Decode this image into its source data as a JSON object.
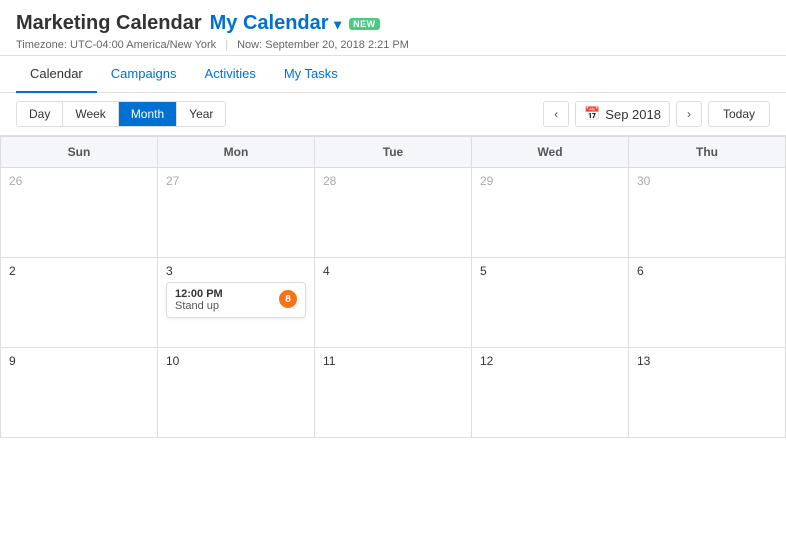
{
  "header": {
    "title": "Marketing Calendar",
    "my_calendar_label": "My Calendar",
    "chevron": "▾",
    "new_badge": "NEW",
    "timezone_label": "Timezone: UTC-04:00 America/New York",
    "now_label": "Now: September 20, 2018 2:21 PM"
  },
  "tabs": [
    {
      "label": "Calendar",
      "active": true
    },
    {
      "label": "Campaigns",
      "active": false
    },
    {
      "label": "Activities",
      "active": false
    },
    {
      "label": "My Tasks",
      "active": false
    }
  ],
  "toolbar": {
    "view_buttons": [
      {
        "label": "Day",
        "active": false
      },
      {
        "label": "Week",
        "active": false
      },
      {
        "label": "Month",
        "active": true
      },
      {
        "label": "Year",
        "active": false
      }
    ],
    "prev_arrow": "‹",
    "next_arrow": "›",
    "calendar_icon": "📅",
    "month_label": "Sep 2018",
    "today_label": "Today"
  },
  "calendar": {
    "weekdays": [
      "Sun",
      "Mon",
      "Tue",
      "Wed",
      "Thu"
    ],
    "weeks": [
      [
        {
          "day": "26",
          "prev": true,
          "events": []
        },
        {
          "day": "27",
          "prev": true,
          "events": []
        },
        {
          "day": "28",
          "prev": true,
          "events": []
        },
        {
          "day": "29",
          "prev": true,
          "events": []
        },
        {
          "day": "30",
          "prev": true,
          "events": []
        }
      ],
      [
        {
          "day": "2",
          "prev": false,
          "events": []
        },
        {
          "day": "3",
          "prev": false,
          "events": [
            {
              "time": "12:00 PM",
              "name": "Stand up",
              "badge": "8"
            }
          ]
        },
        {
          "day": "4",
          "prev": false,
          "events": []
        },
        {
          "day": "5",
          "prev": false,
          "events": []
        },
        {
          "day": "6",
          "prev": false,
          "events": []
        }
      ],
      [
        {
          "day": "9",
          "prev": false,
          "events": []
        },
        {
          "day": "10",
          "prev": false,
          "events": []
        },
        {
          "day": "11",
          "prev": false,
          "events": []
        },
        {
          "day": "12",
          "prev": false,
          "events": []
        },
        {
          "day": "13",
          "prev": false,
          "events": []
        }
      ]
    ]
  }
}
